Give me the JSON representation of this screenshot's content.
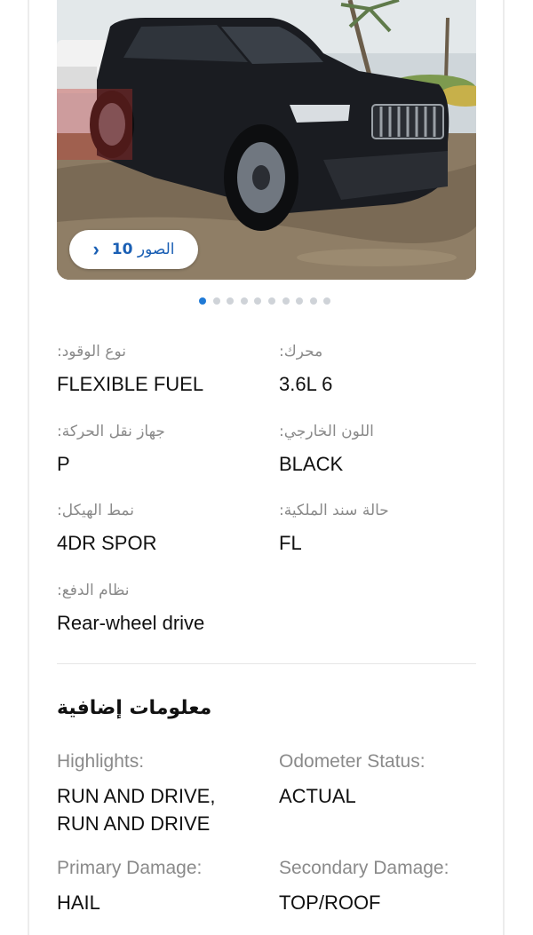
{
  "gallery": {
    "photos_button": {
      "label": "الصور",
      "count": "10",
      "icon": "chevron-right-icon"
    },
    "pager": {
      "total": 10,
      "active_index": 0
    }
  },
  "specs": [
    {
      "label": ":نوع الوقود",
      "value": "FLEXIBLE FUEL"
    },
    {
      "label": ":محرك",
      "value": "3.6L 6"
    },
    {
      "label": ":جهاز نقل الحركة",
      "value": "P"
    },
    {
      "label": ":اللون الخارجي",
      "value": "BLACK"
    },
    {
      "label": ":نمط الهيكل",
      "value": "4DR SPOR"
    },
    {
      "label": ":حالة سند الملكية",
      "value": "FL"
    },
    {
      "label": ":نظام الدفع",
      "value": "Rear-wheel drive"
    }
  ],
  "additional": {
    "title": "معلومات إضافية",
    "items": [
      {
        "label": "Highlights:",
        "value": "RUN AND DRIVE, RUN AND DRIVE"
      },
      {
        "label": "Odometer Status:",
        "value": "ACTUAL"
      },
      {
        "label": "Primary Damage:",
        "value": "HAIL"
      },
      {
        "label": "Secondary Damage:",
        "value": "TOP/ROOF"
      }
    ]
  },
  "colors": {
    "accent": "#1f7ad6",
    "link": "#1a5fb4",
    "muted": "#8a8a8a"
  }
}
